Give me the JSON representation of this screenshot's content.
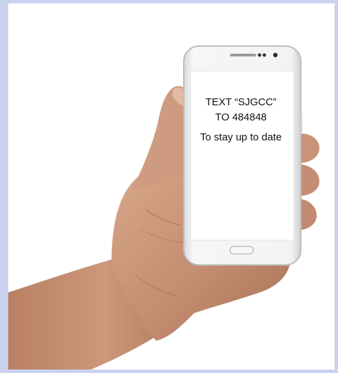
{
  "phone_screen": {
    "line1": "TEXT “SJGCC”",
    "line2": "TO 484848",
    "line3": "To stay up to date"
  },
  "colors": {
    "outer_border": "#c9d3ef",
    "phone_body": "#f1f1f1",
    "screen": "#ffffff",
    "skin": "#c9957a"
  },
  "icons": {
    "speaker": "speaker-grille-icon",
    "camera": "front-camera-icon",
    "home": "home-button-icon"
  }
}
